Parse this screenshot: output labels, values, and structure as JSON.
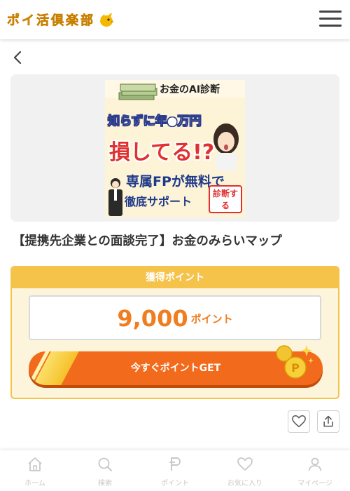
{
  "header": {
    "logo_text": "ポイ活倶楽部",
    "logo_icon": "bird-icon",
    "menu_icon": "hamburger-icon"
  },
  "nav": {
    "back_icon": "chevron-left-icon"
  },
  "banner": {
    "top_text": "お金のAI診断",
    "line1": "知らずに年●万円",
    "line2": "損してる!?",
    "line3": "専属FPが無料で",
    "line4": "徹底サポート",
    "badge": "診断する"
  },
  "offer": {
    "title": "【提携先企業との面談完了】お金のみらいマップ"
  },
  "points": {
    "header": "獲得ポイント",
    "value": "9,000",
    "unit": "ポイント",
    "button_label": "今すぐポイントGET"
  },
  "actions": {
    "favorite_icon": "heart-icon",
    "share_icon": "share-icon"
  },
  "bottom_nav": {
    "items": [
      {
        "label": "ホーム",
        "icon": "home-icon"
      },
      {
        "label": "検索",
        "icon": "search-icon"
      },
      {
        "label": "ポイント",
        "icon": "point-icon"
      },
      {
        "label": "お気に入り",
        "icon": "heart-icon"
      },
      {
        "label": "マイページ",
        "icon": "user-icon"
      }
    ]
  },
  "colors": {
    "accent_orange": "#f26a1b",
    "points_text": "#f07d1f",
    "card_border": "#f5c24a",
    "card_bg": "#fdf4dc",
    "logo": "#f5a500",
    "nav_inactive": "#c8c8c8"
  }
}
